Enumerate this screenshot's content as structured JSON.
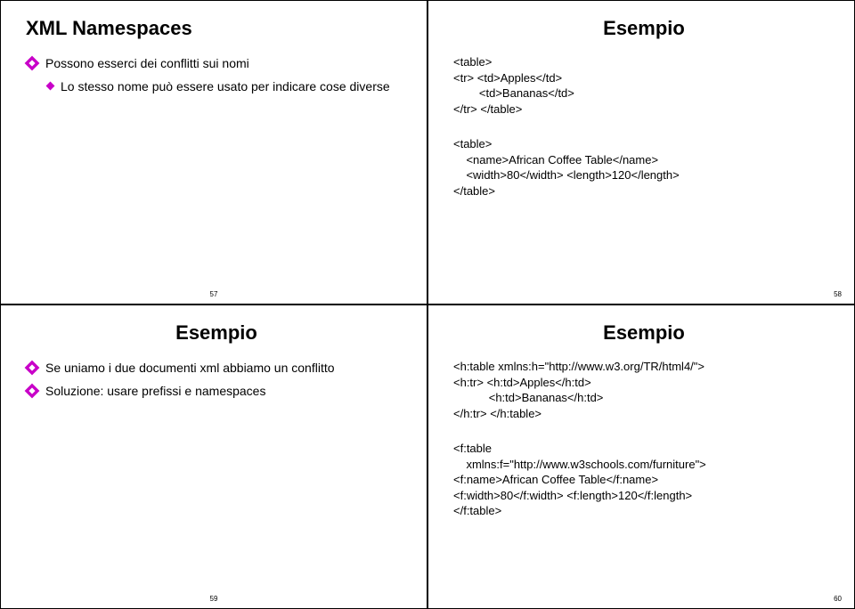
{
  "slides": {
    "s1": {
      "title": "XML Namespaces",
      "b1": "Possono esserci dei conflitti sui nomi",
      "b2": "Lo stesso nome può essere usato per indicare cose diverse",
      "page": "57"
    },
    "s2": {
      "title": "Esempio",
      "code1": "<table>\n<tr> <td>Apples</td>\n        <td>Bananas</td>\n</tr> </table>",
      "code2": "<table>\n    <name>African Coffee Table</name>\n    <width>80</width> <length>120</length>\n</table>",
      "page": "58"
    },
    "s3": {
      "title": "Esempio",
      "b1": "Se uniamo i due documenti xml abbiamo un conflitto",
      "b2": "Soluzione: usare prefissi e namespaces",
      "page": "59"
    },
    "s4": {
      "title": "Esempio",
      "code1": "<h:table xmlns:h=\"http://www.w3.org/TR/html4/\">\n<h:tr> <h:td>Apples</h:td>\n           <h:td>Bananas</h:td>\n</h:tr> </h:table>",
      "code2": "<f:table\n    xmlns:f=\"http://www.w3schools.com/furniture\">\n<f:name>African Coffee Table</f:name>\n<f:width>80</f:width> <f:length>120</f:length>\n</f:table>",
      "page": "60"
    }
  }
}
